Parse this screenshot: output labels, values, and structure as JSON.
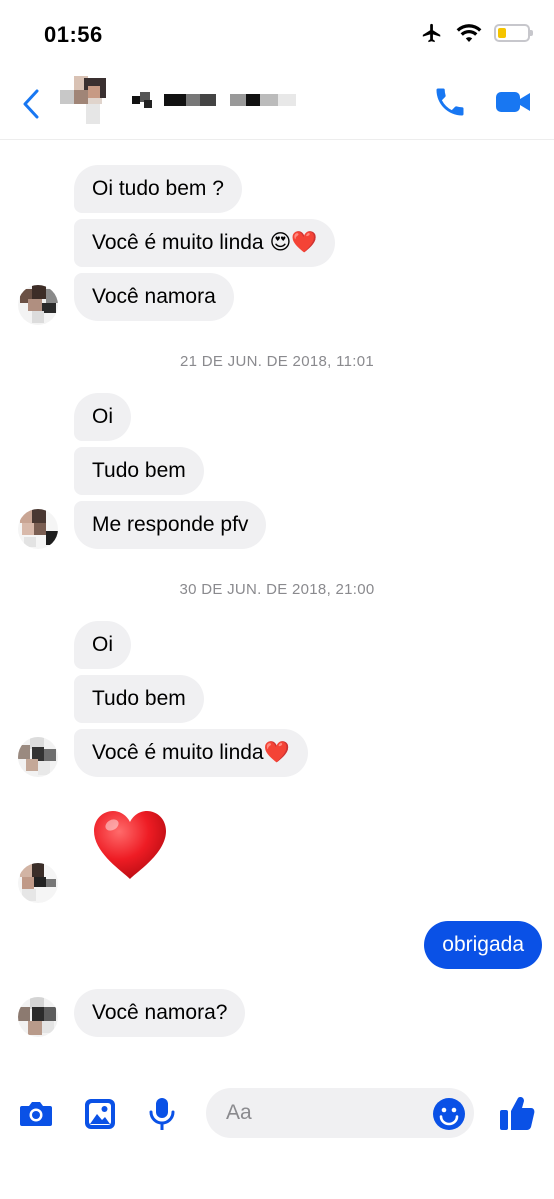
{
  "status_bar": {
    "time": "01:56",
    "battery_level": 0.3,
    "battery_color": "#f5c400"
  },
  "header": {
    "accent": "#1877f2"
  },
  "conversation": {
    "bubble_color": "#f0f0f2",
    "outgoing_color": "#0a51e6",
    "groups": [
      {
        "messages": [
          "Oi tudo bem ?",
          "Você é muito linda 😍❤️",
          "Você namora"
        ]
      },
      {
        "timestamp": "21 DE JUN. DE 2018, 11:01",
        "messages": [
          "Oi",
          "Tudo bem",
          "Me responde pfv"
        ]
      },
      {
        "timestamp": "30 DE JUN. DE 2018, 21:00",
        "messages": [
          "Oi",
          "Tudo bem",
          "Você é muito linda❤️"
        ]
      },
      {
        "messages": [
          "❤️"
        ]
      },
      {
        "outgoing": [
          "obrigada"
        ]
      },
      {
        "messages": [
          "Você namora?"
        ]
      }
    ]
  },
  "composer": {
    "placeholder": "Aa",
    "accent": "#0a51e6"
  }
}
